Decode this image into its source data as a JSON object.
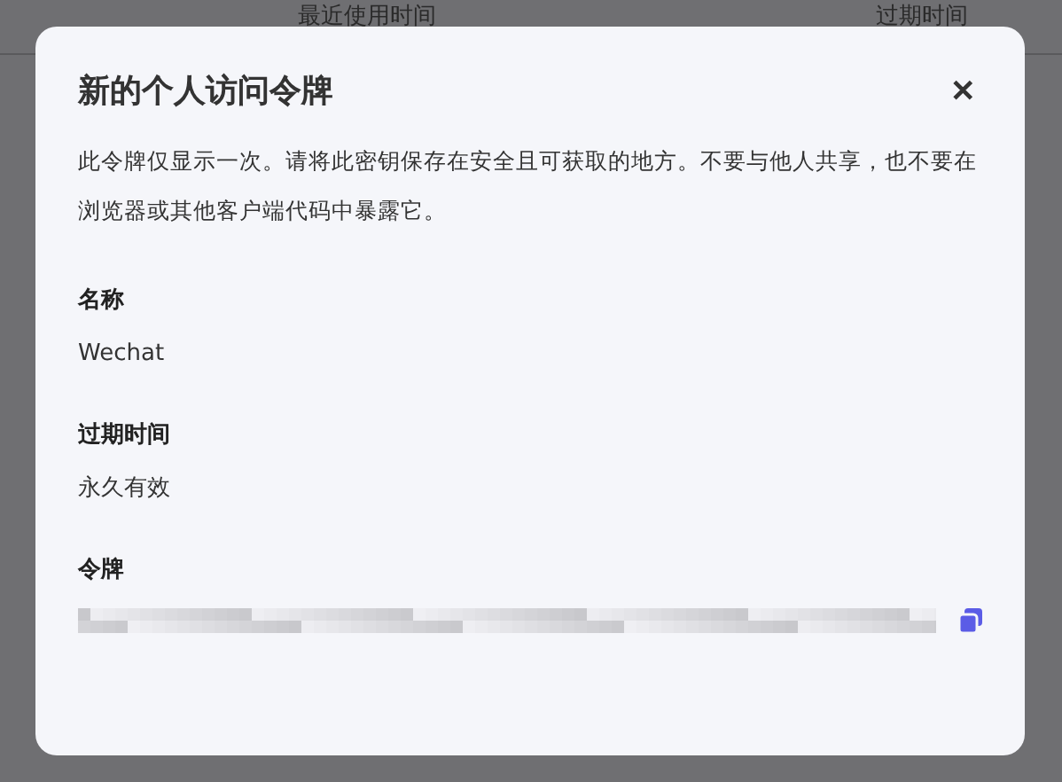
{
  "background_table": {
    "columns": [
      "最近使用时间",
      "过期时间"
    ]
  },
  "dialog": {
    "title": "新的个人访问令牌",
    "close": "✕",
    "description": "此令牌仅显示一次。请将此密钥保存在安全且可获取的地方。不要与他人共享，也不要在浏览器或其他客户端代码中暴露它。",
    "fields": [
      {
        "label": "名称",
        "value": "Wechat",
        "kind": "text"
      },
      {
        "label": "过期时间",
        "value": "永久有效",
        "kind": "text"
      },
      {
        "label": "令牌",
        "kind": "secret"
      }
    ]
  }
}
